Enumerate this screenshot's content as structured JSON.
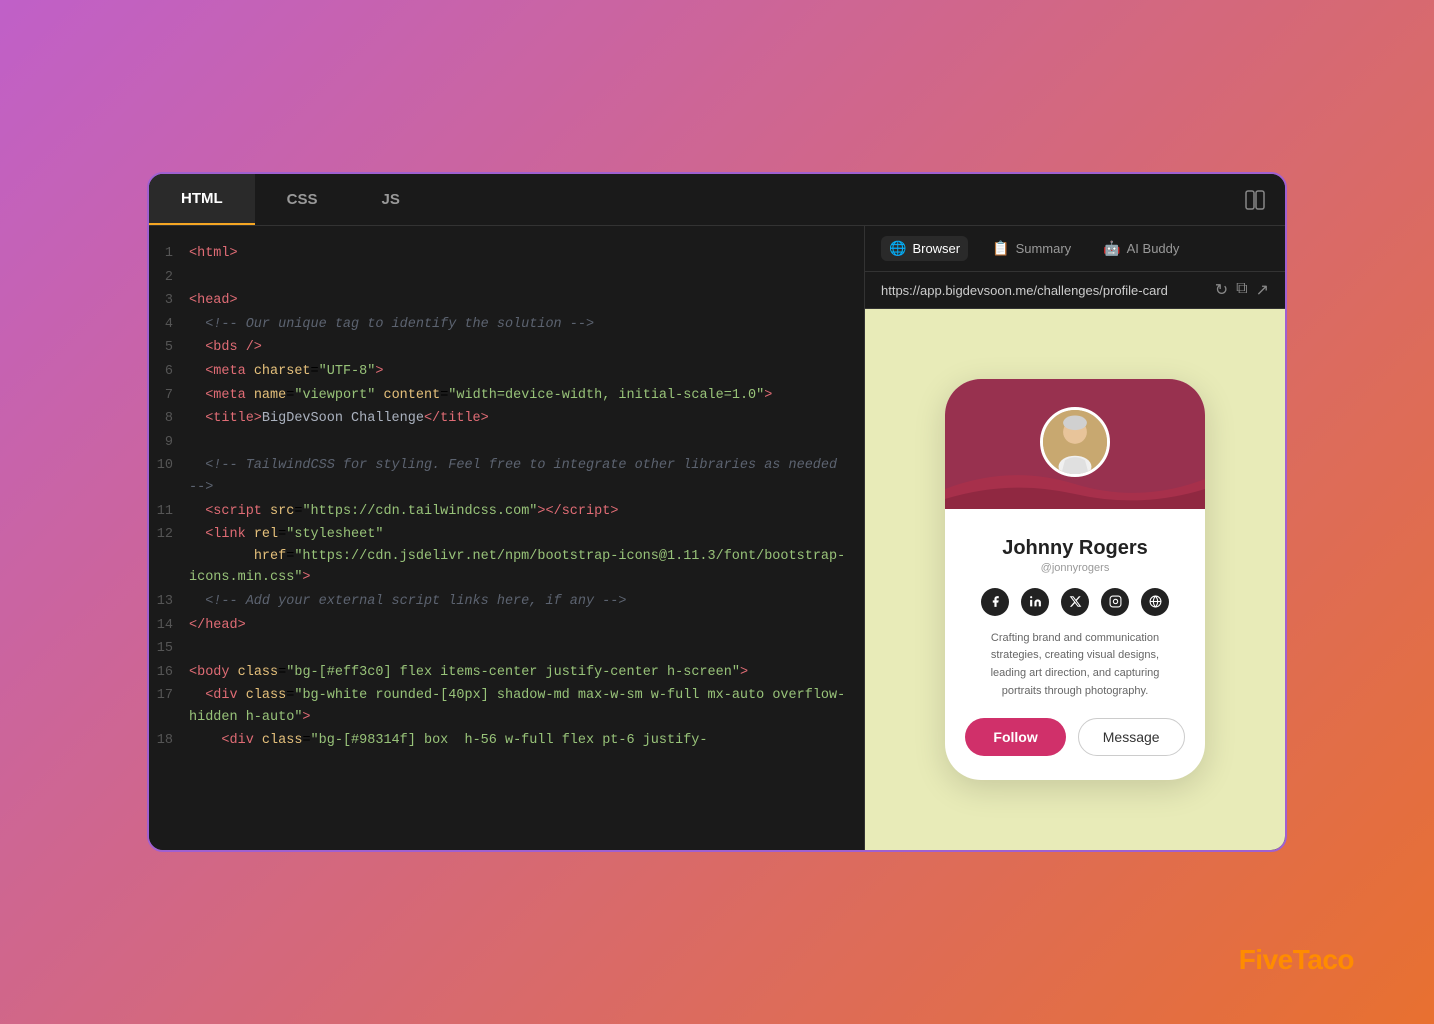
{
  "window": {
    "border_color": "#a060d0"
  },
  "tabs": {
    "left": [
      {
        "id": "html",
        "label": "HTML",
        "active": true
      },
      {
        "id": "css",
        "label": "CSS",
        "active": false
      },
      {
        "id": "js",
        "label": "JS",
        "active": false
      }
    ],
    "browser_tabs": [
      {
        "id": "browser",
        "label": "Browser",
        "icon": "🌐",
        "active": true
      },
      {
        "id": "summary",
        "label": "Summary",
        "icon": "📋",
        "active": false
      },
      {
        "id": "ai-buddy",
        "label": "AI Buddy",
        "icon": "🤖",
        "active": false
      }
    ]
  },
  "address_bar": {
    "url": "https://app.bigdevsoon.me/challenges/profile-card"
  },
  "code_lines": [
    {
      "num": 1,
      "content": "<html>"
    },
    {
      "num": 2,
      "content": ""
    },
    {
      "num": 3,
      "content": "<head>"
    },
    {
      "num": 4,
      "content": "  <!-- Our unique tag to identify the solution -->"
    },
    {
      "num": 5,
      "content": "  <bds />"
    },
    {
      "num": 6,
      "content": "  <meta charset=\"UTF-8\">"
    },
    {
      "num": 7,
      "content": "  <meta name=\"viewport\" content=\"width=device-width, initial-scale=1.0\">"
    },
    {
      "num": 8,
      "content": "  <title>BigDevSoon Challenge</title>"
    },
    {
      "num": 9,
      "content": ""
    },
    {
      "num": 10,
      "content": "  <!-- TailwindCSS for styling. Feel free to integrate other libraries as needed -->"
    },
    {
      "num": 11,
      "content": "  <script src=\"https://cdn.tailwindcss.com\"></scri"
    },
    {
      "num": 12,
      "content": "  <link rel=\"stylesheet\" href=\"https://cdn.jsdelivr.net/npm/bootstrap-icons@1.11.3/font/bootstrap-icons.min.css\">"
    },
    {
      "num": 13,
      "content": "  <!-- Add your external script links here, if any -->"
    },
    {
      "num": 14,
      "content": "</head>"
    },
    {
      "num": 15,
      "content": ""
    },
    {
      "num": 16,
      "content": "<body class=\"bg-[#eff3c0] flex items-center justify-center h-screen\">"
    },
    {
      "num": 17,
      "content": "  <div class=\"bg-white rounded-[40px] shadow-md max-w-sm w-full mx-auto overflow-hidden h-auto\">"
    },
    {
      "num": 18,
      "content": "    <div class=\"bg-[#98314f] box  h-56 w-full flex pt-6 justify-"
    }
  ],
  "profile_card": {
    "name": "Johnny Rogers",
    "username": "@jonnyrogers",
    "bio": "Crafting brand and communication strategies, creating visual designs, leading art direction, and capturing portraits through photography.",
    "buttons": {
      "follow": "Follow",
      "message": "Message"
    },
    "social_links": [
      "facebook",
      "linkedin",
      "twitter-x",
      "instagram",
      "globe"
    ]
  },
  "logo": {
    "text_white": "Five",
    "text_orange": "Taco"
  }
}
